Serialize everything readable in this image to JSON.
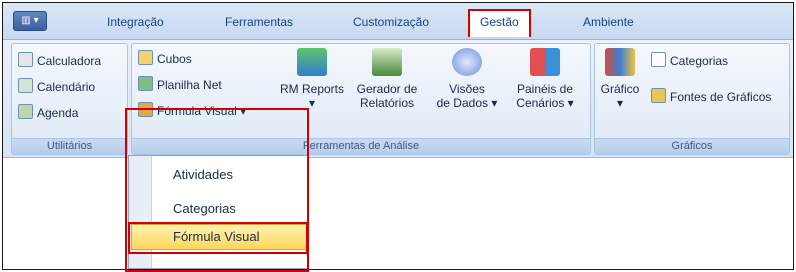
{
  "tabs": {
    "app_menu": "▥ ▾",
    "items": [
      "Integração",
      "Ferramentas",
      "Customização",
      "Gestão",
      "Ambiente"
    ]
  },
  "groups": {
    "utilitarios": {
      "label": "Utilitários",
      "items": [
        "Calculadora",
        "Calendário",
        "Agenda"
      ]
    },
    "analise": {
      "label": "Ferramentas de Análise",
      "small_items": [
        "Cubos",
        "Planilha Net",
        "Fórmula Visual ▾"
      ],
      "rm_reports": "RM Reports\n▾",
      "gerador": "Gerador de\nRelatórios",
      "visoes": "Visões\nde Dados ▾",
      "paineis": "Painéis de\nCenários ▾"
    },
    "graficos": {
      "label": "Gráficos",
      "grafico": "Gráfico\n▾",
      "categorias": "Categorias",
      "fontes": "Fontes de Gráficos"
    }
  },
  "dropdown": {
    "items": [
      "Atividades",
      "Categorias",
      "Fórmula Visual"
    ]
  },
  "colors": {
    "highlight": "#d40000",
    "selection": "#ffd65b"
  }
}
